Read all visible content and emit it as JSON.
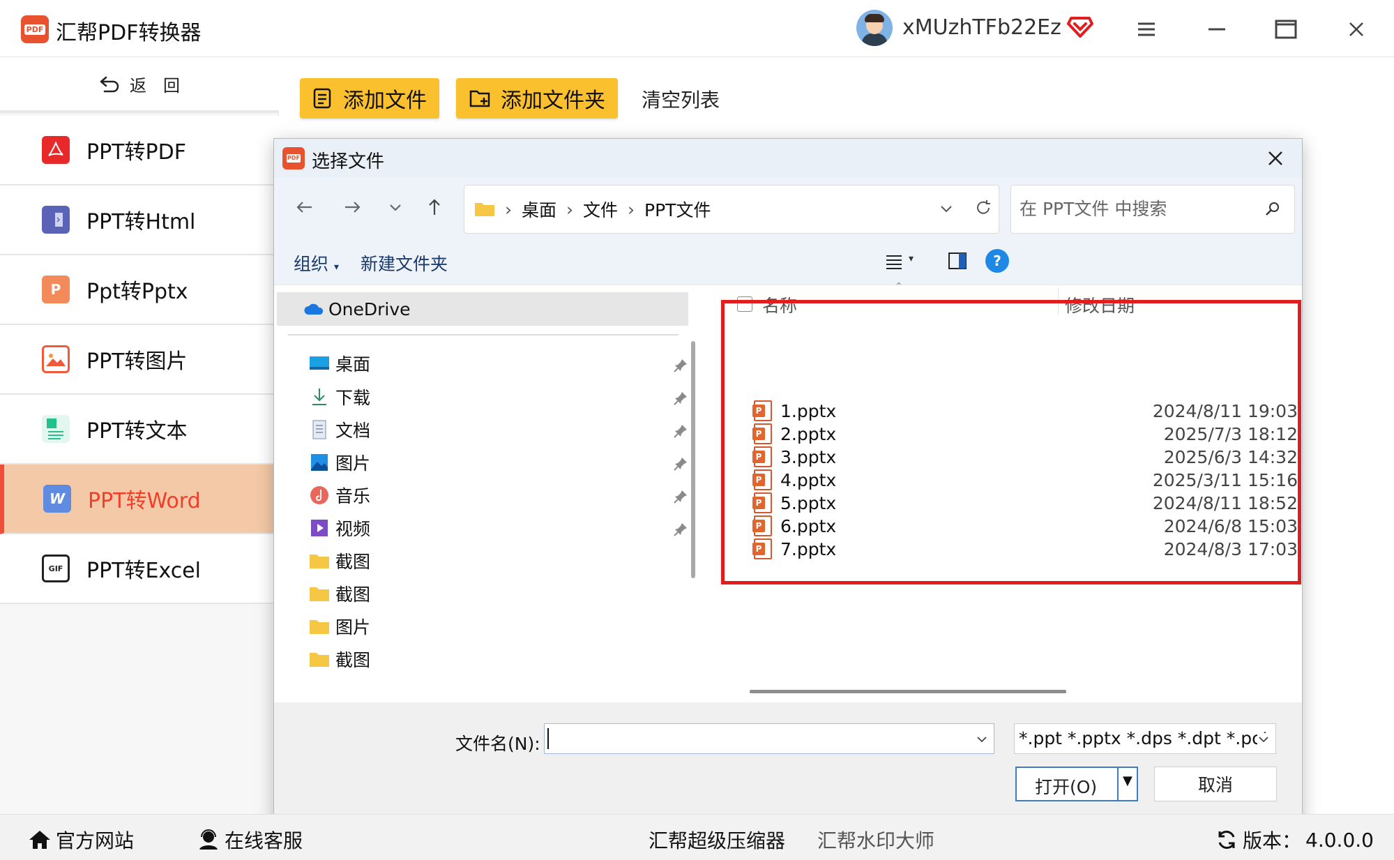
{
  "app": {
    "title": "汇帮PDF转换器",
    "username": "xMUzhTFb22Ez",
    "accent": "#fbc02d",
    "active_color": "#ef3f2a"
  },
  "sidebar": {
    "back_label": "返　回",
    "items": [
      {
        "label": "PPT转PDF",
        "icon": "pdf-icon"
      },
      {
        "label": "PPT转Html",
        "icon": "html-icon"
      },
      {
        "label": "Ppt转Pptx",
        "icon": "pptx-icon"
      },
      {
        "label": "PPT转图片",
        "icon": "image-icon"
      },
      {
        "label": "PPT转文本",
        "icon": "text-icon"
      },
      {
        "label": "PPT转Word",
        "icon": "word-icon",
        "active": true
      },
      {
        "label": "PPT转Excel",
        "icon": "excel-icon"
      }
    ]
  },
  "toolbar": {
    "add_file": "添加文件",
    "add_folder": "添加文件夹",
    "clear_list": "清空列表"
  },
  "dialog": {
    "title": "选择文件",
    "breadcrumb": [
      "桌面",
      "文件",
      "PPT文件"
    ],
    "search_placeholder": "在 PPT文件 中搜索",
    "organize": "组织",
    "new_folder": "新建文件夹",
    "tree": {
      "onedrive": "OneDrive",
      "items": [
        {
          "label": "桌面",
          "icon": "desktop-icon",
          "pinned": true
        },
        {
          "label": "下载",
          "icon": "download-icon",
          "pinned": true
        },
        {
          "label": "文档",
          "icon": "document-icon",
          "pinned": true
        },
        {
          "label": "图片",
          "icon": "pictures-icon",
          "pinned": true
        },
        {
          "label": "音乐",
          "icon": "music-icon",
          "pinned": true
        },
        {
          "label": "视频",
          "icon": "video-icon",
          "pinned": true
        },
        {
          "label": "截图",
          "icon": "folder-icon",
          "pinned": false
        },
        {
          "label": "截图",
          "icon": "folder-icon",
          "pinned": false
        },
        {
          "label": "图片",
          "icon": "folder-icon",
          "pinned": false
        },
        {
          "label": "截图",
          "icon": "folder-icon",
          "pinned": false
        }
      ]
    },
    "columns": {
      "name": "名称",
      "modified": "修改日期"
    },
    "files": [
      {
        "name": "1.pptx",
        "modified": "2024/8/11 19:03"
      },
      {
        "name": "2.pptx",
        "modified": "2025/7/3 18:12"
      },
      {
        "name": "3.pptx",
        "modified": "2025/6/3 14:32"
      },
      {
        "name": "4.pptx",
        "modified": "2025/3/11 15:16"
      },
      {
        "name": "5.pptx",
        "modified": "2024/8/11 18:52"
      },
      {
        "name": "6.pptx",
        "modified": "2024/6/8 15:03"
      },
      {
        "name": "7.pptx",
        "modified": "2024/8/3 17:03"
      }
    ],
    "filename_label": "文件名(N):",
    "filename_value": "",
    "filetype": "*.ppt *.pptx *.dps *.dpt *.pot *",
    "open_label": "打开(O)",
    "cancel_label": "取消",
    "highlight_color": "#e31d1d"
  },
  "bottombar": {
    "website": "官方网站",
    "support": "在线客服",
    "compressor": "汇帮超级压缩器",
    "watermark": "汇帮水印大师",
    "version_label": "版本：",
    "version": "4.0.0.0"
  }
}
